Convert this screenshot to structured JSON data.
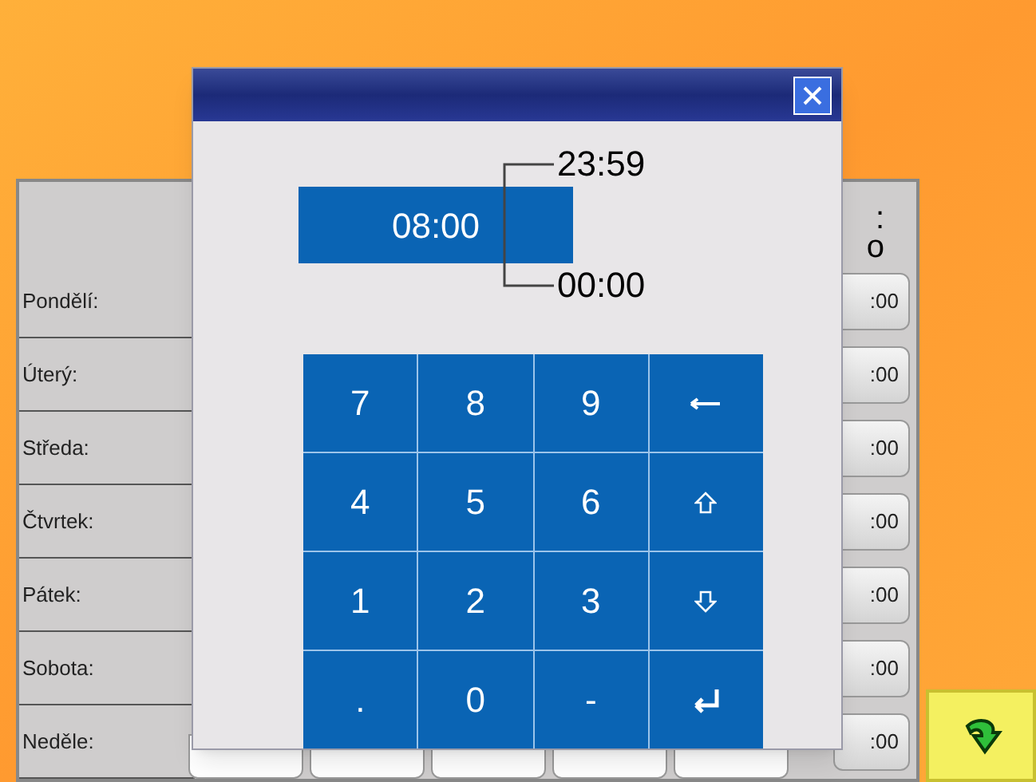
{
  "schedule": {
    "header": [
      ":",
      "o"
    ],
    "days": [
      {
        "label": "Pondělí:",
        "time": ":00"
      },
      {
        "label": "Úterý:",
        "time": ":00"
      },
      {
        "label": "Středa:",
        "time": ":00"
      },
      {
        "label": "Čtvrtek:",
        "time": ":00"
      },
      {
        "label": "Pátek:",
        "time": ":00"
      },
      {
        "label": "Sobota:",
        "time": ":00"
      },
      {
        "label": "Neděle:",
        "time": ":00"
      }
    ]
  },
  "dialog": {
    "value": "08:00",
    "max": "23:59",
    "min": "00:00",
    "keys": [
      {
        "kind": "text",
        "label": "7"
      },
      {
        "kind": "text",
        "label": "8"
      },
      {
        "kind": "text",
        "label": "9"
      },
      {
        "kind": "backspace"
      },
      {
        "kind": "text",
        "label": "4"
      },
      {
        "kind": "text",
        "label": "5"
      },
      {
        "kind": "text",
        "label": "6"
      },
      {
        "kind": "up"
      },
      {
        "kind": "text",
        "label": "1"
      },
      {
        "kind": "text",
        "label": "2"
      },
      {
        "kind": "text",
        "label": "3"
      },
      {
        "kind": "down"
      },
      {
        "kind": "text",
        "label": "."
      },
      {
        "kind": "text",
        "label": "0"
      },
      {
        "kind": "text",
        "label": "-"
      },
      {
        "kind": "enter"
      }
    ]
  }
}
